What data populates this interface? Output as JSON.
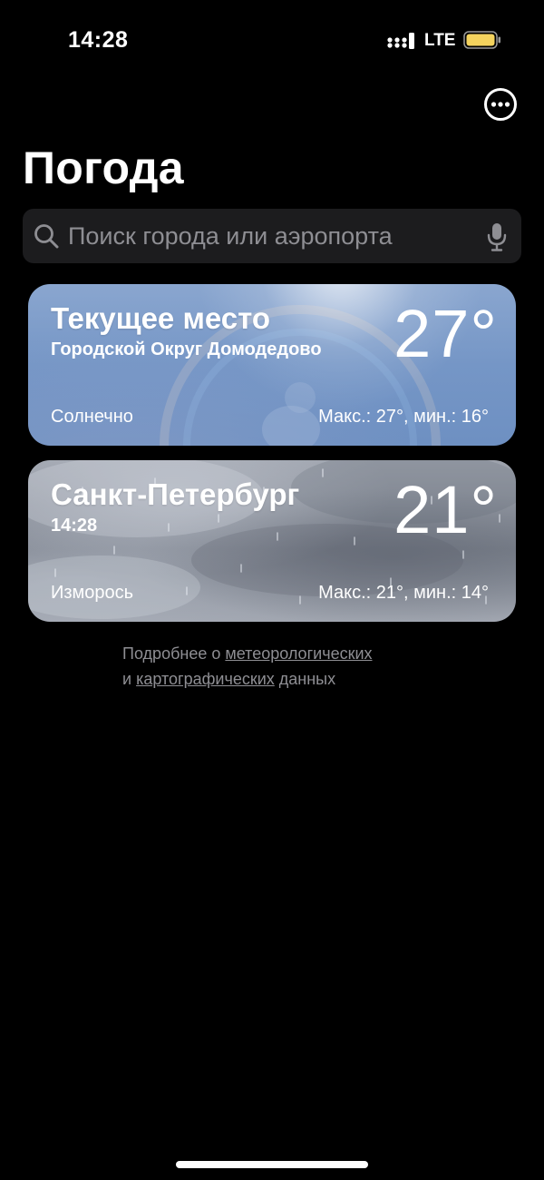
{
  "status_bar": {
    "time": "14:28",
    "network": "LTE",
    "battery_color": "#f4d35e"
  },
  "header": {
    "title": "Погода",
    "more_icon": "ellipsis-circle-icon"
  },
  "search": {
    "placeholder": "Поиск города или аэропорта",
    "value": "",
    "search_icon": "magnifying-glass-icon",
    "mic_icon": "microphone-icon"
  },
  "locations": [
    {
      "name": "Текущее место",
      "subtitle": "Городской Округ Домодедово",
      "temperature": "27°",
      "condition": "Солнечно",
      "range": "Макс.: 27°, мин.: 16°",
      "background": "sunny"
    },
    {
      "name": "Санкт-Петербург",
      "subtitle": "14:28",
      "temperature": "21°",
      "condition": "Изморось",
      "range": "Макс.: 21°, мин.: 14°",
      "background": "rain"
    }
  ],
  "footer_note": {
    "prefix": "Подробнее о ",
    "link1": "метеорологических",
    "middle": "и ",
    "link2": "картографических",
    "suffix": " данных"
  },
  "colors": {
    "background": "#000000",
    "search_field": "#1c1c1e",
    "secondary_text": "#8e8e93"
  }
}
